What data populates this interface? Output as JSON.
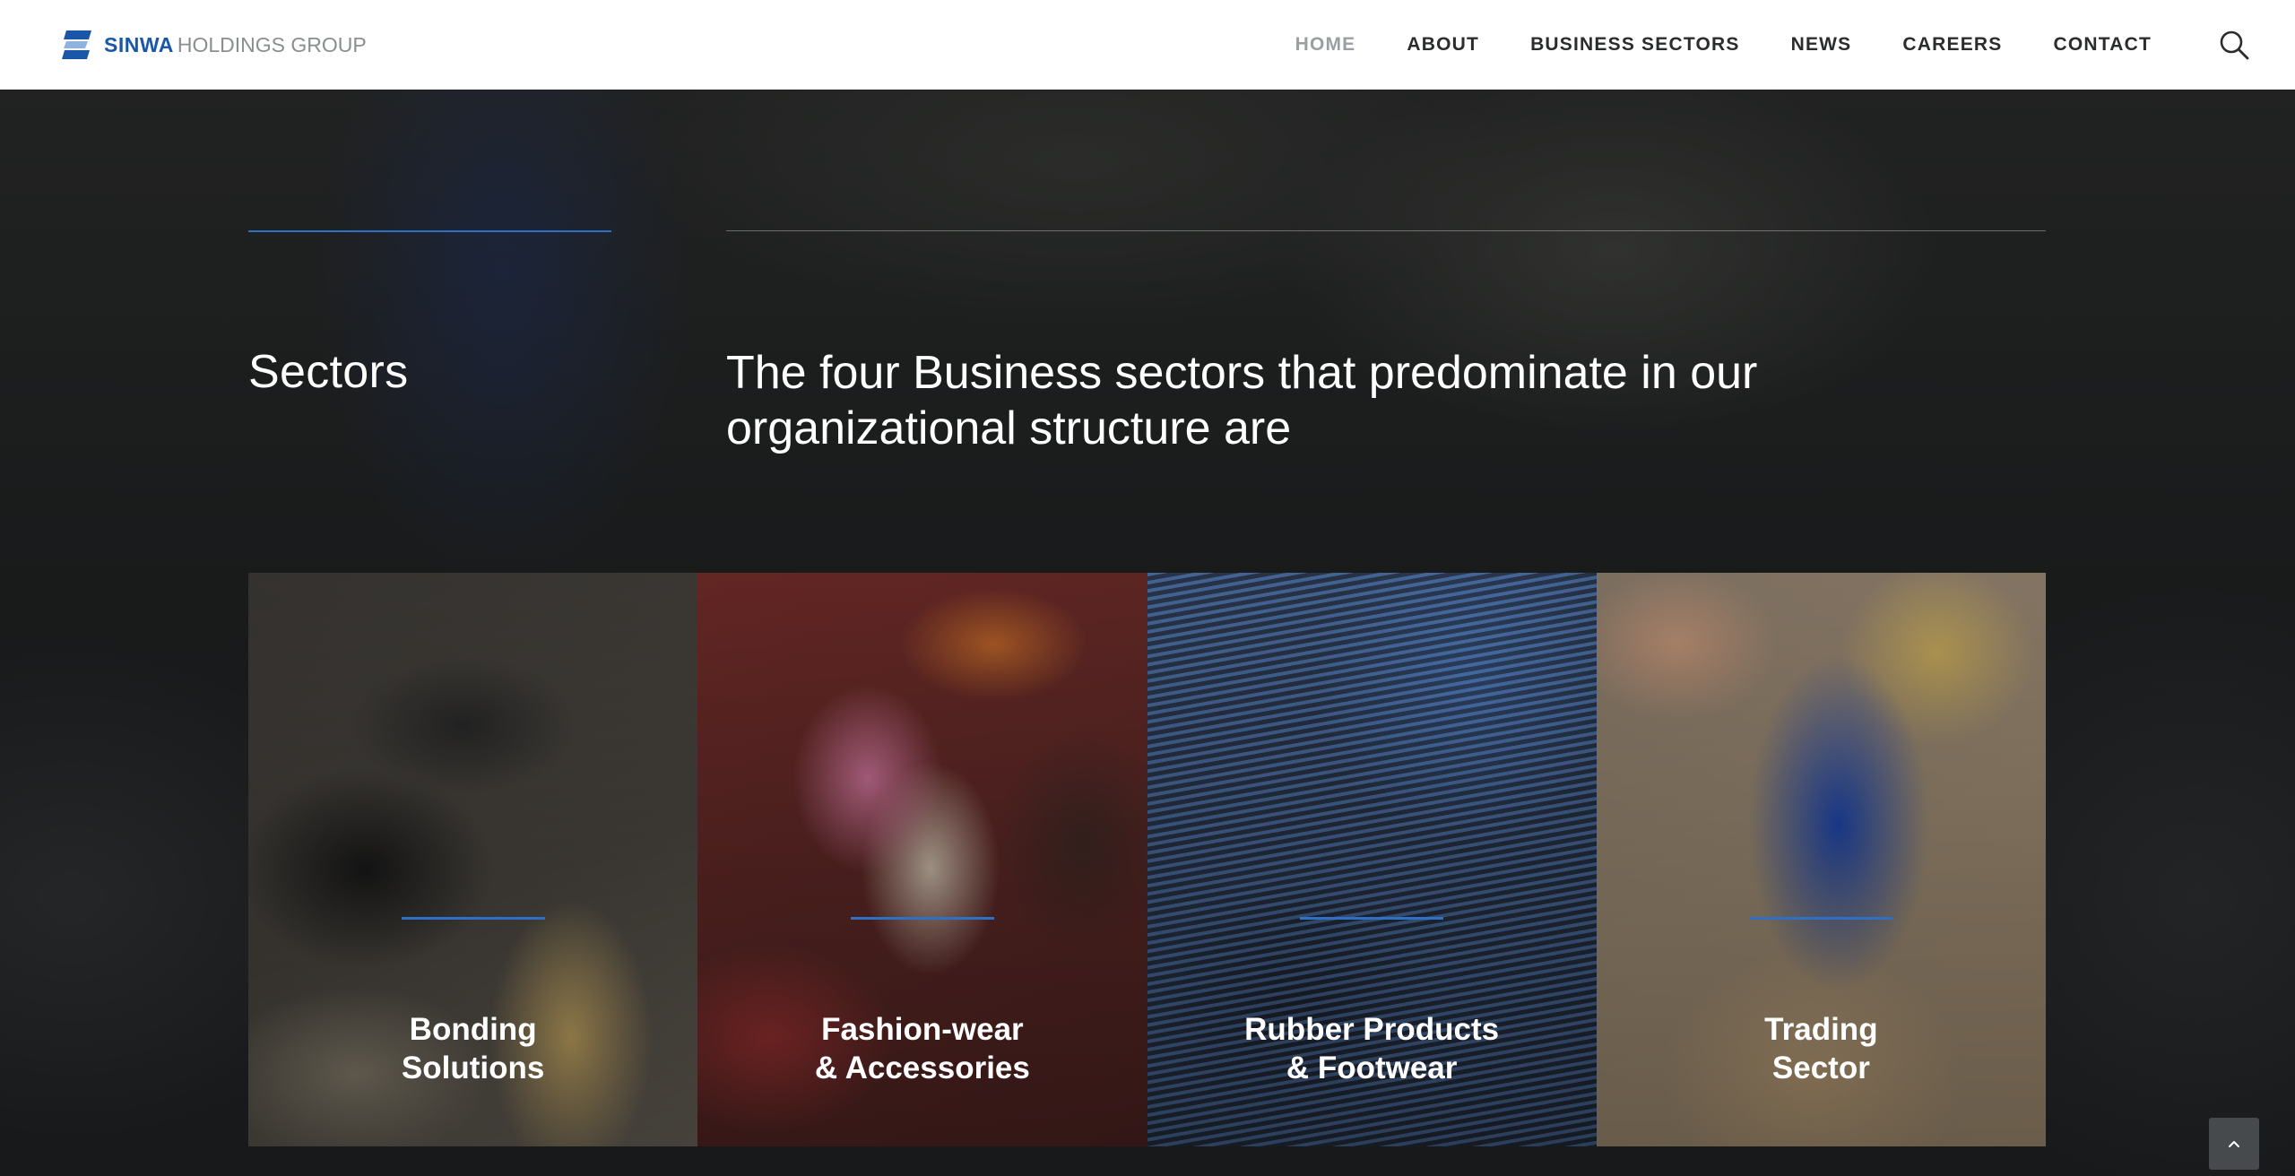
{
  "brand": {
    "name_bold": "SINWA",
    "name_light": "HOLDINGS GROUP",
    "accent_color": "#1a57a8"
  },
  "nav": {
    "items": [
      {
        "label": "HOME",
        "active": true
      },
      {
        "label": "ABOUT",
        "active": false
      },
      {
        "label": "BUSINESS SECTORS",
        "active": false
      },
      {
        "label": "NEWS",
        "active": false
      },
      {
        "label": "CAREERS",
        "active": false
      },
      {
        "label": "CONTACT",
        "active": false
      }
    ],
    "search_icon": "search-icon"
  },
  "hero": {
    "title": "Sectors",
    "description": "The four Business sectors that predominate in our organizational structure are",
    "rule_color": "#2f6fc4"
  },
  "cards": [
    {
      "line1": "Bonding",
      "line2": "Solutions"
    },
    {
      "line1": "Fashion-wear",
      "line2": "& Accessories"
    },
    {
      "line1": "Rubber Products",
      "line2": "& Footwear"
    },
    {
      "line1": "Trading",
      "line2": "Sector"
    }
  ],
  "back_to_top": {
    "icon": "chevron-up-icon"
  }
}
